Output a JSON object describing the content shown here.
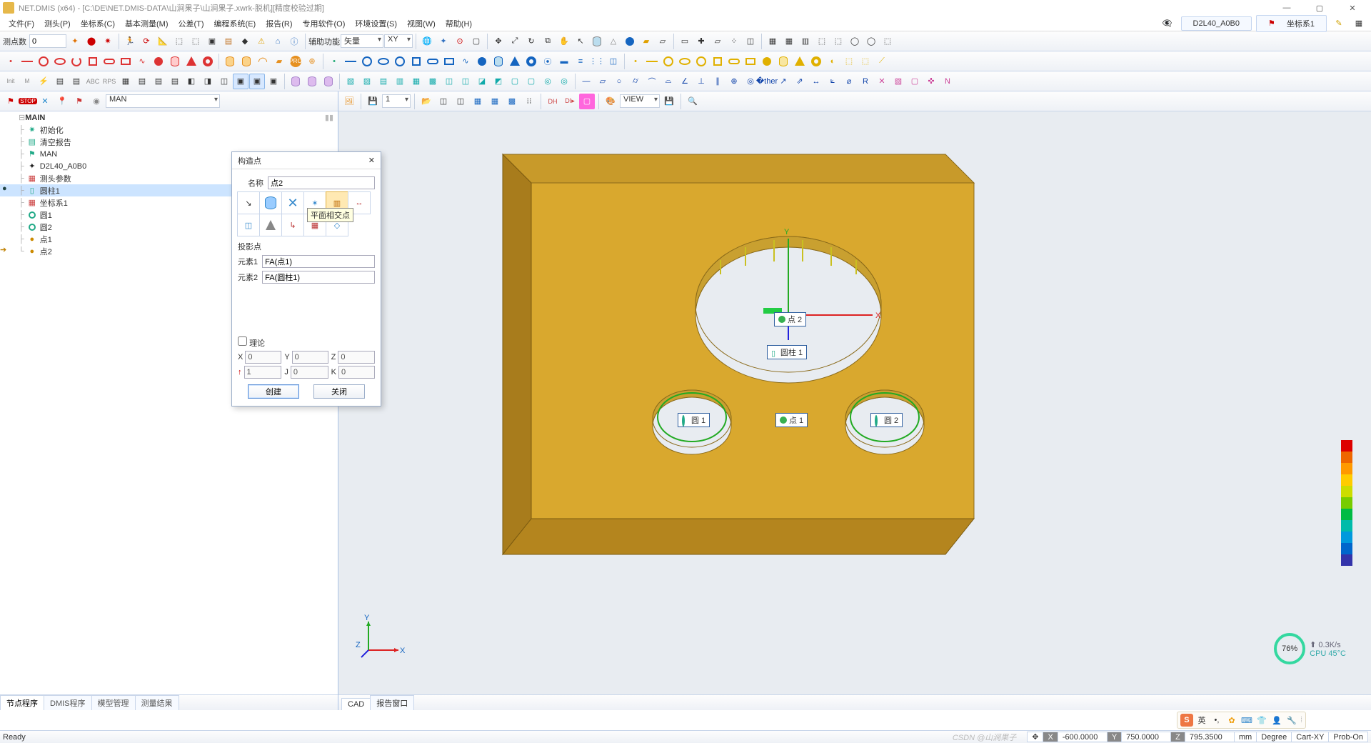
{
  "app": {
    "title": "NET.DMIS (x64) - [C:\\DE\\NET.DMIS-DATA\\山涧果子\\山涧果子.xwrk-脱机][精度校验过期]"
  },
  "menu": [
    "文件(F)",
    "测头(P)",
    "坐标系(C)",
    "基本测量(M)",
    "公差(T)",
    "编程系统(E)",
    "报告(R)",
    "专用软件(O)",
    "环境设置(S)",
    "视图(W)",
    "帮助(H)"
  ],
  "menu_right": {
    "probe": "D2L40_A0B0",
    "crs_icon": "⚑",
    "crs": "坐标系1"
  },
  "toolbar1": {
    "points_label": "测点数",
    "points_value": "0",
    "aux_label": "辅助功能",
    "aux_combo": "矢量",
    "plane_combo": "XY"
  },
  "runbar": {
    "mode": "MAN"
  },
  "tree": {
    "root": "MAIN",
    "items": [
      {
        "icon": "gear",
        "label": "初始化"
      },
      {
        "icon": "doc",
        "label": "清空报告"
      },
      {
        "icon": "mode",
        "label": "MAN"
      },
      {
        "icon": "probe",
        "label": "D2L40_A0B0"
      },
      {
        "icon": "sheet",
        "label": "测头参数"
      },
      {
        "icon": "cyl",
        "label": "圆柱1",
        "sel": true
      },
      {
        "icon": "crs",
        "label": "坐标系1"
      },
      {
        "icon": "circ",
        "label": "圆1"
      },
      {
        "icon": "circ",
        "label": "圆2"
      },
      {
        "icon": "pt",
        "label": "点1"
      },
      {
        "icon": "pt",
        "label": "点2"
      }
    ]
  },
  "left_tabs": [
    "节点程序",
    "DMIS程序",
    "模型管理",
    "测量结果"
  ],
  "right_tabs": [
    "CAD",
    "报告窗口"
  ],
  "view_bar": {
    "combo": "1",
    "view_combo": "VIEW"
  },
  "dialog": {
    "title": "构造点",
    "name_label": "名称",
    "name_value": "点2",
    "grid_tooltip": "平面相交点",
    "proj_label": "投影点",
    "e1_label": "元素1",
    "e1_value": "FA(点1)",
    "e2_label": "元素2",
    "e2_value": "FA(圆柱1)",
    "theo_label": "理论",
    "coords": {
      "X": "0",
      "Y": "0",
      "Z": "0",
      "I": "1",
      "J": "0",
      "K": "0"
    },
    "btn_create": "创建",
    "btn_close": "关闭"
  },
  "scene": {
    "labels": {
      "pt2": "点 2",
      "cyl1": "圆柱 1",
      "c1": "圆 1",
      "pt1": "点 1",
      "c2": "圆 2"
    },
    "axes": {
      "x": "X",
      "y": "Y",
      "z": "Z"
    }
  },
  "status": {
    "ready": "Ready",
    "X": "-600.0000",
    "Y": "750.0000",
    "Z": "795.3500",
    "unit": "mm",
    "ang": "Degree",
    "proj": "Cart-XY",
    "probe": "Prob-On",
    "watermark": "CSDN @山涧果子"
  },
  "gauge": {
    "pct": "76",
    "unit": "%",
    "net": "0.3K/s",
    "cpu": "CPU 45°C"
  },
  "tray": {
    "ime1": "S",
    "ime2": "英",
    "sep": "⁞"
  }
}
